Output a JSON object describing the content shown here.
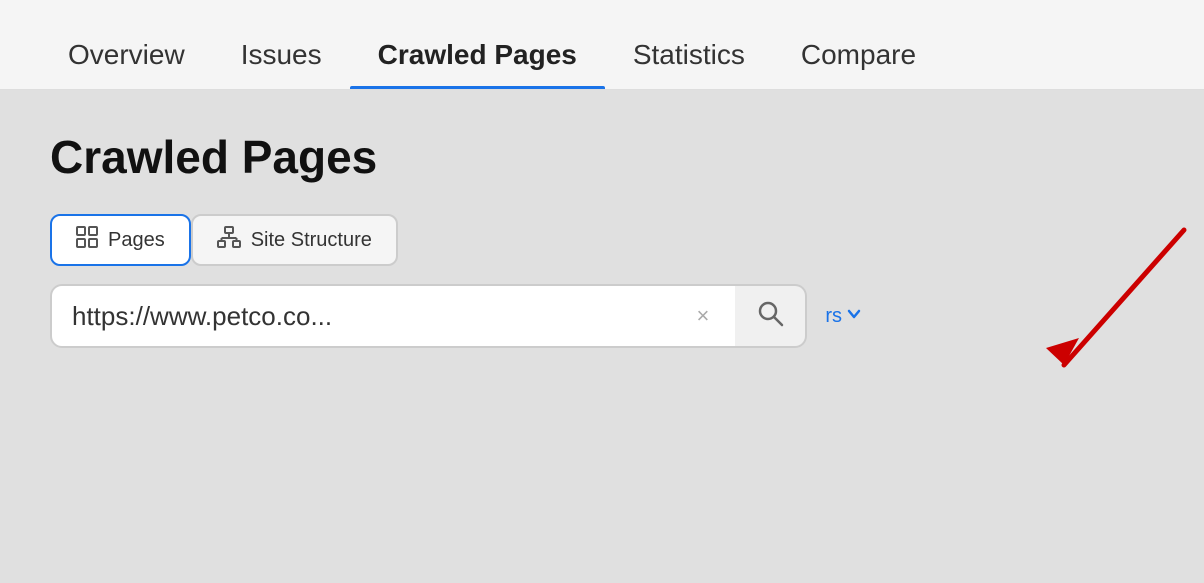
{
  "nav": {
    "tabs": [
      {
        "label": "Overview",
        "active": false
      },
      {
        "label": "Issues",
        "active": false
      },
      {
        "label": "Crawled Pages",
        "active": true
      },
      {
        "label": "Statistics",
        "active": false
      },
      {
        "label": "Compare",
        "active": false
      }
    ]
  },
  "main": {
    "page_title": "Crawled Pages",
    "toggle_buttons": [
      {
        "label": "Pages",
        "active": true,
        "icon": "pages-icon"
      },
      {
        "label": "Site Structure",
        "active": false,
        "icon": "site-structure-icon"
      }
    ],
    "search": {
      "value": "https://www.petco.co...",
      "clear_label": "×",
      "search_icon": "search-icon"
    },
    "filters_label": "rs",
    "chevron_label": "▾"
  }
}
